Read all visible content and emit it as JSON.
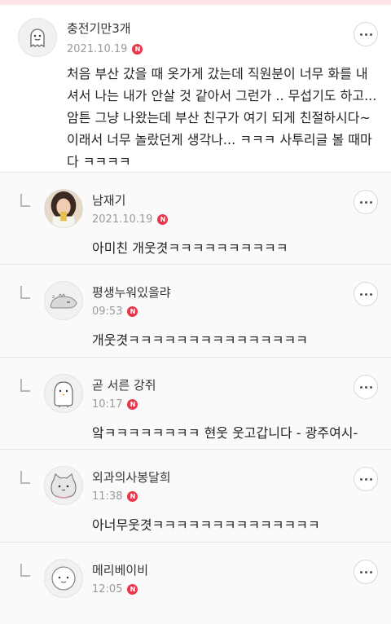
{
  "comments": [
    {
      "name": "충전기만3개",
      "date": "2021.10.19",
      "badge": "N",
      "avatar_icon": "ghost-character-icon",
      "text": "처음 부산 갔을 때 옷가게 갔는데 직원분이 너무 화를 내셔서 나는 내가 안살 것 같아서 그런가 .. 무섭기도 하고... 암튼 그냥 나왔는데 부산 친구가 여기 되게 친절하시다~ 이래서 너무 놀랐던게 생각나... ㅋㅋㅋ 사투리글 볼 때마다 ㅋㅋㅋㅋ"
    }
  ],
  "replies": [
    {
      "name": "남재기",
      "date": "2021.10.19",
      "badge": "N",
      "avatar_icon": "user-photo-avatar",
      "text": "아미친 개웃겻ㅋㅋㅋㅋㅋㅋㅋㅋㅋㅋ"
    },
    {
      "name": "평생누워있을랴",
      "date": "09:53",
      "badge": "N",
      "avatar_icon": "sleeping-dino-icon",
      "text": "개웃겻ㅋㅋㅋㅋㅋㅋㅋㅋㅋㅋㅋㅋㅋㅋㅋ"
    },
    {
      "name": "곧 서른 강쥐",
      "date": "10:17",
      "badge": "N",
      "avatar_icon": "penguin-character-icon",
      "text": "앜ㅋㅋㅋㅋㅋㅋㅋㅋ 현웃 웃고갑니다 - 광주여시-"
    },
    {
      "name": "외과의사봉달희",
      "date": "11:38",
      "badge": "N",
      "avatar_icon": "cat-character-icon",
      "text": "아너무웃겻ㅋㅋㅋㅋㅋㅋㅋㅋㅋㅋㅋㅋㅋㅋ"
    },
    {
      "name": "메리베이비",
      "date": "12:05",
      "badge": "N",
      "avatar_icon": "round-face-character-icon",
      "text": ""
    }
  ]
}
